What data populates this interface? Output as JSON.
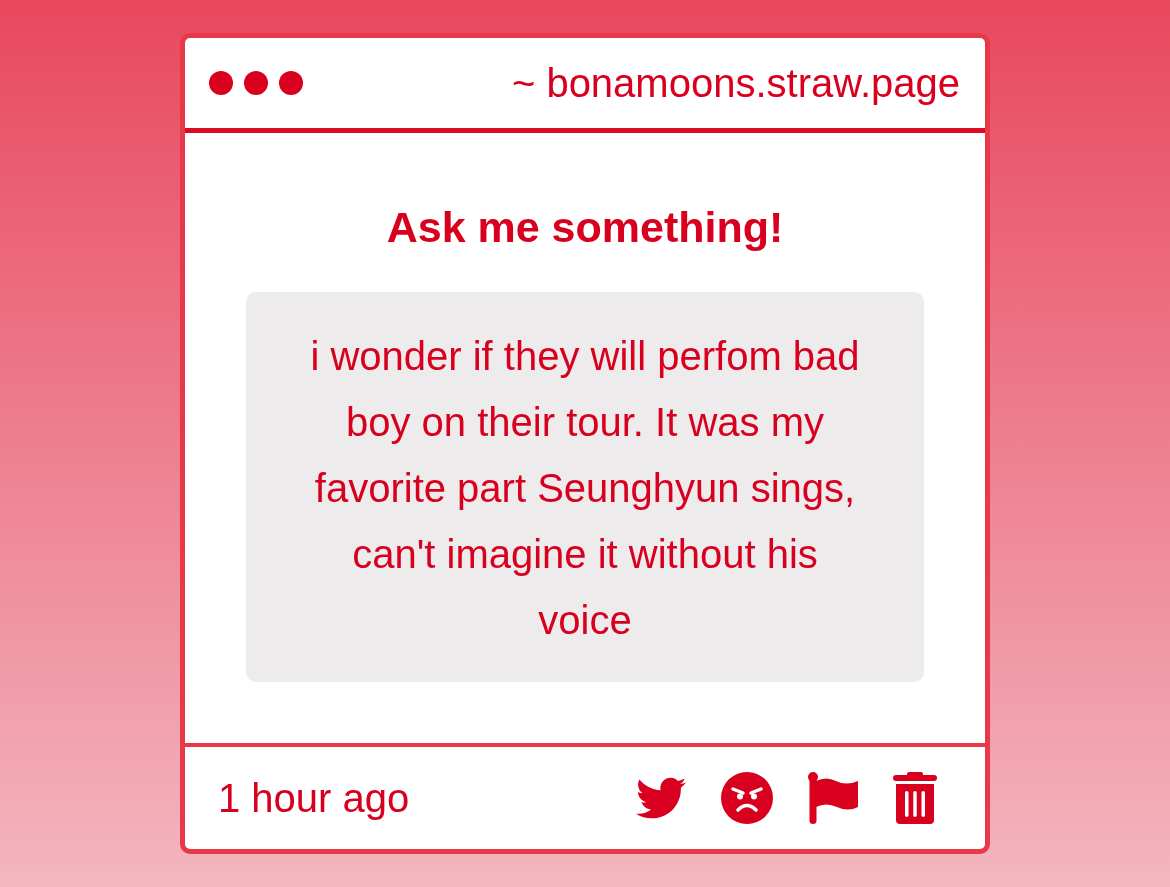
{
  "window": {
    "address": "~ bonamoons.straw.page"
  },
  "prompt": {
    "title": "Ask me something!",
    "question": "i wonder if they will perfom bad boy on their tour. It was my favorite part Seunghyun sings, can't imagine it without his voice"
  },
  "footer": {
    "timestamp": "1 hour ago",
    "actions": [
      {
        "kind": "tweet"
      },
      {
        "kind": "angry"
      },
      {
        "kind": "report"
      },
      {
        "kind": "delete"
      }
    ]
  }
}
